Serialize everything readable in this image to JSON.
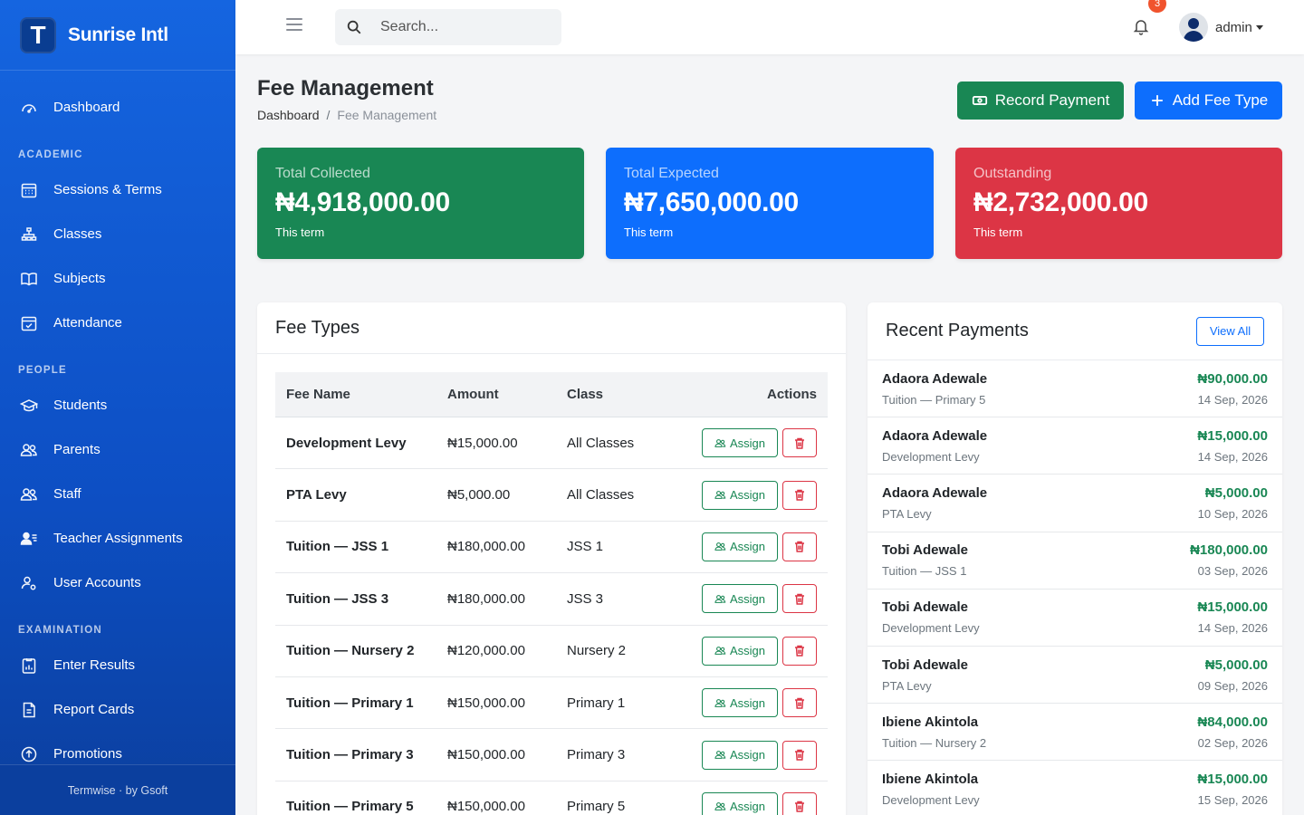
{
  "brand": {
    "logo_letter": "T",
    "name": "Sunrise Intl"
  },
  "sidebar": {
    "dashboard": "Dashboard",
    "sections": {
      "academic": "ACADEMIC",
      "people": "PEOPLE",
      "examination": "EXAMINATION"
    },
    "items": {
      "sessions": "Sessions & Terms",
      "classes": "Classes",
      "subjects": "Subjects",
      "attendance": "Attendance",
      "students": "Students",
      "parents": "Parents",
      "staff": "Staff",
      "teacher_assignments": "Teacher Assignments",
      "user_accounts": "User Accounts",
      "enter_results": "Enter Results",
      "report_cards": "Report Cards",
      "promotions": "Promotions"
    },
    "footer": "Termwise · by Gsoft"
  },
  "topbar": {
    "search_placeholder": "Search...",
    "notification_count": "3",
    "user_name": "admin"
  },
  "page": {
    "title": "Fee Management",
    "breadcrumb": {
      "home": "Dashboard",
      "separator": "/",
      "current": "Fee Management"
    },
    "record_payment_label": "Record Payment",
    "add_fee_type_label": "Add Fee Type"
  },
  "stats": {
    "collected": {
      "label": "Total Collected",
      "value": "₦4,918,000.00",
      "sub": "This term",
      "color": "#198754"
    },
    "expected": {
      "label": "Total Expected",
      "value": "₦7,650,000.00",
      "sub": "This term",
      "color": "#0d6efd"
    },
    "outstanding": {
      "label": "Outstanding",
      "value": "₦2,732,000.00",
      "sub": "This term",
      "color": "#dc3545"
    }
  },
  "fee_types": {
    "title": "Fee Types",
    "columns": {
      "name": "Fee Name",
      "amount": "Amount",
      "class": "Class",
      "actions": "Actions"
    },
    "assign_label": "Assign",
    "rows": [
      {
        "name": "Development Levy",
        "amount": "₦15,000.00",
        "class": "All Classes"
      },
      {
        "name": "PTA Levy",
        "amount": "₦5,000.00",
        "class": "All Classes"
      },
      {
        "name": "Tuition — JSS 1",
        "amount": "₦180,000.00",
        "class": "JSS 1"
      },
      {
        "name": "Tuition — JSS 3",
        "amount": "₦180,000.00",
        "class": "JSS 3"
      },
      {
        "name": "Tuition — Nursery 2",
        "amount": "₦120,000.00",
        "class": "Nursery 2"
      },
      {
        "name": "Tuition — Primary 1",
        "amount": "₦150,000.00",
        "class": "Primary 1"
      },
      {
        "name": "Tuition — Primary 3",
        "amount": "₦150,000.00",
        "class": "Primary 3"
      },
      {
        "name": "Tuition — Primary 5",
        "amount": "₦150,000.00",
        "class": "Primary 5"
      }
    ]
  },
  "recent_payments": {
    "title": "Recent Payments",
    "view_all_label": "View All",
    "items": [
      {
        "name": "Adaora Adewale",
        "amount": "₦90,000.00",
        "fee": "Tuition — Primary 5",
        "date": "14 Sep, 2026"
      },
      {
        "name": "Adaora Adewale",
        "amount": "₦15,000.00",
        "fee": "Development Levy",
        "date": "14 Sep, 2026"
      },
      {
        "name": "Adaora Adewale",
        "amount": "₦5,000.00",
        "fee": "PTA Levy",
        "date": "10 Sep, 2026"
      },
      {
        "name": "Tobi Adewale",
        "amount": "₦180,000.00",
        "fee": "Tuition — JSS 1",
        "date": "03 Sep, 2026"
      },
      {
        "name": "Tobi Adewale",
        "amount": "₦15,000.00",
        "fee": "Development Levy",
        "date": "14 Sep, 2026"
      },
      {
        "name": "Tobi Adewale",
        "amount": "₦5,000.00",
        "fee": "PTA Levy",
        "date": "09 Sep, 2026"
      },
      {
        "name": "Ibiene Akintola",
        "amount": "₦84,000.00",
        "fee": "Tuition — Nursery 2",
        "date": "02 Sep, 2026"
      },
      {
        "name": "Ibiene Akintola",
        "amount": "₦15,000.00",
        "fee": "Development Levy",
        "date": "15 Sep, 2026"
      }
    ]
  }
}
